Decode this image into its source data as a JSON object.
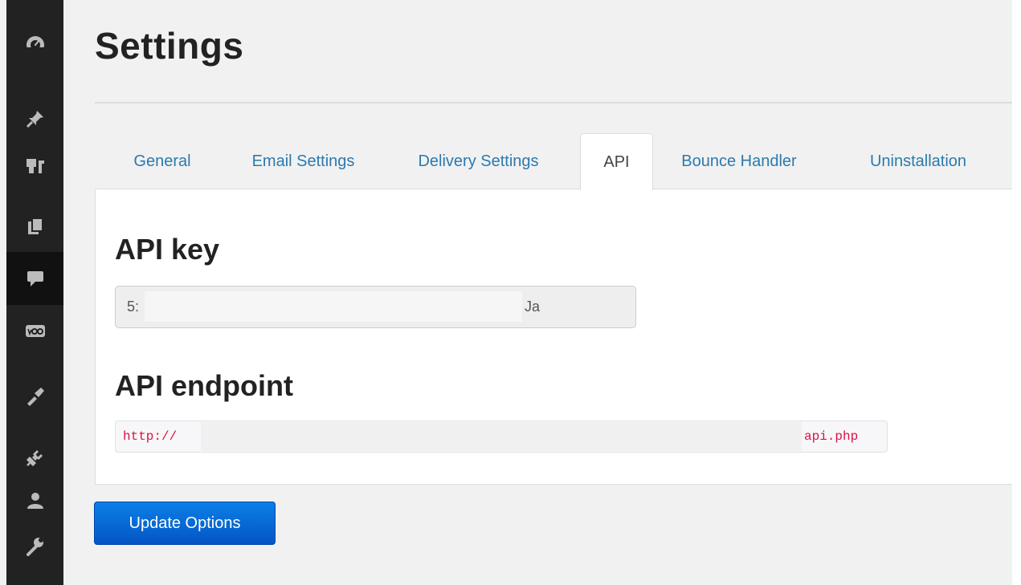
{
  "page": {
    "title": "Settings"
  },
  "sidebar": {
    "items": [
      {
        "icon": "dashboard-icon"
      },
      {
        "icon": "pin-icon"
      },
      {
        "icon": "media-icon"
      },
      {
        "icon": "pages-icon"
      },
      {
        "icon": "comments-icon",
        "active": true
      },
      {
        "icon": "woo-icon"
      },
      {
        "icon": "appearance-icon"
      },
      {
        "icon": "plugins-icon"
      },
      {
        "icon": "users-icon"
      },
      {
        "icon": "tools-icon"
      }
    ]
  },
  "tabs": [
    {
      "label": "General"
    },
    {
      "label": "Email Settings"
    },
    {
      "label": "Delivery Settings"
    },
    {
      "label": "API",
      "active": true
    },
    {
      "label": "Bounce Handler"
    },
    {
      "label": "Uninstallation"
    }
  ],
  "api": {
    "key_heading": "API key",
    "key_value_start": "5:",
    "key_value_end": "Ja",
    "endpoint_heading": "API endpoint",
    "endpoint_start": "http://",
    "endpoint_end": "api.php"
  },
  "actions": {
    "update_label": "Update Options"
  },
  "colors": {
    "link": "#2a7ab0",
    "button": "#0a6fd9",
    "code": "#dd1144",
    "sidebar": "#222222"
  }
}
